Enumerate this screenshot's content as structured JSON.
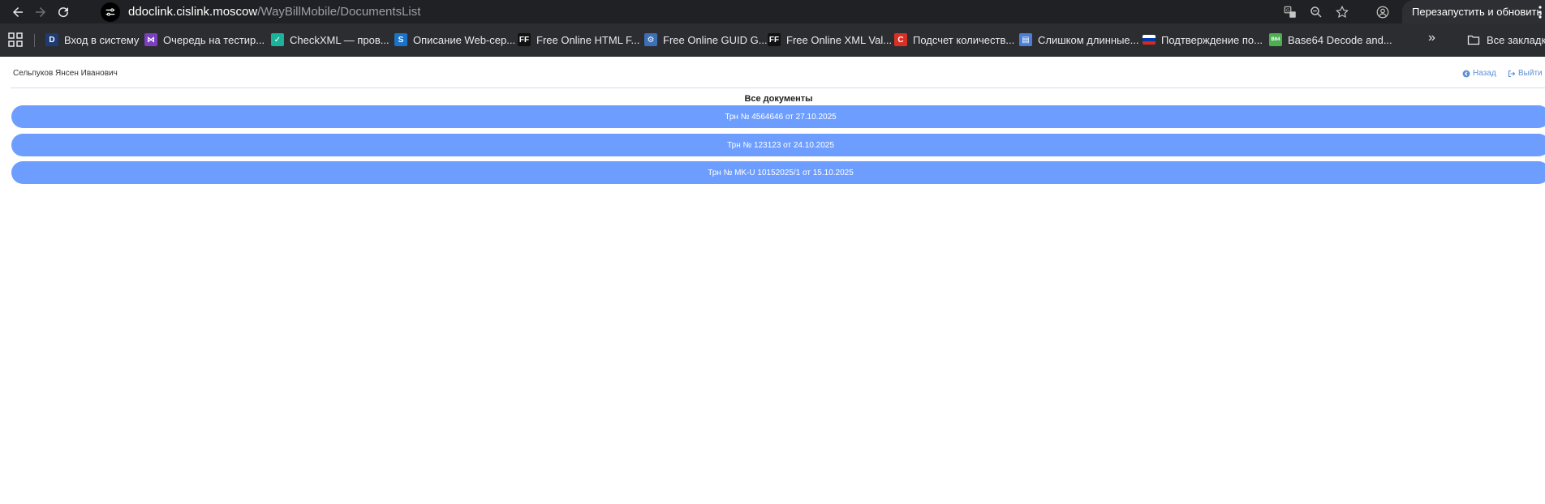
{
  "browser": {
    "url_host": "ddoclink.cislink.moscow",
    "url_path": "/WayBillMobile/DocumentsList",
    "relaunch_label": "Перезапустить и обновить",
    "bookmarks": [
      {
        "label": "Вход в систему",
        "icon": "d-letter-icon",
        "fav_text": "D",
        "color": "#1f3b73"
      },
      {
        "label": "Очередь на тестир...",
        "icon": "visual-studio-icon",
        "fav_text": "⋈",
        "color": "#7b3fbf"
      },
      {
        "label": "CheckXML — пров...",
        "icon": "checkxml-icon",
        "fav_text": "✓",
        "color": "#1bb39a"
      },
      {
        "label": "Описание Web-сер...",
        "icon": "web-service-icon",
        "fav_text": "S",
        "color": "#1a73c7"
      },
      {
        "label": "Free Online HTML F...",
        "icon": "freeformatter-icon",
        "fav_text": "FF",
        "color": "#111111"
      },
      {
        "label": "Free Online GUID G...",
        "icon": "gear-icon",
        "fav_text": "⚙",
        "color": "#3c6fb6"
      },
      {
        "label": "Free Online XML Val...",
        "icon": "freeformatter-icon",
        "fav_text": "FF",
        "color": "#111111"
      },
      {
        "label": "Подсчет количеств...",
        "icon": "copyright-icon",
        "fav_text": "C",
        "color": "#d93025"
      },
      {
        "label": "Слишком длинные...",
        "icon": "document-icon",
        "fav_text": "▤",
        "color": "#4a7fd4"
      },
      {
        "label": "Подтверждение по...",
        "icon": "russia-flag-icon",
        "fav_text": "",
        "color": "#d52b1e"
      },
      {
        "label": "Base64 Decode and...",
        "icon": "base64-icon",
        "fav_text": "B64",
        "color": "#4caf50"
      }
    ],
    "all_bookmarks_label": "Все закладки"
  },
  "header": {
    "user_name": "Сельпуков Янсен Иванович",
    "back_label": "Назад",
    "logout_label": "Выйти"
  },
  "section_title": "Все документы",
  "documents": [
    {
      "label": "Трн № 4564646 от 27.10.2025"
    },
    {
      "label": "Трн № 123123 от 24.10.2025"
    },
    {
      "label": "Трн № MK-U 10152025/1 от 15.10.2025"
    }
  ],
  "colors": {
    "accent_button": "#6d9eff",
    "link": "#5b8fd6"
  }
}
